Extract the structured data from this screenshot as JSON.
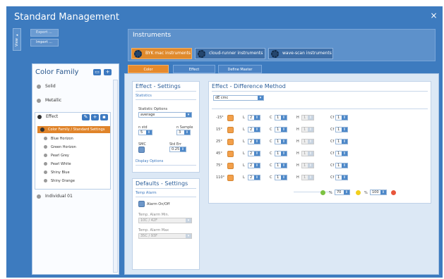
{
  "window": {
    "title": "Standard Management",
    "close_icon": "×",
    "view_tab": "View ▸"
  },
  "top_left_buttons": {
    "export": "Export ...",
    "import": "Import ..."
  },
  "instruments": {
    "title": "Instruments",
    "items": [
      {
        "label": "BYK mac instruments",
        "active": true
      },
      {
        "label": "cloud-runner instruments",
        "active": false
      },
      {
        "label": "wave-scan instruments",
        "active": false
      }
    ]
  },
  "color_family": {
    "title": "Color Family",
    "nodes": [
      "Solid",
      "Metallic",
      "Effect",
      "Individual 01"
    ],
    "effect_selected": "Color Family / Standard Settings",
    "effect_children": [
      "Blue Horizon",
      "Green Horizon",
      "Pearl Grey",
      "Pearl White",
      "Shiny Blue",
      "Shiny Orange"
    ]
  },
  "tabs": [
    "Color",
    "Effect",
    "Define Master"
  ],
  "effect_settings": {
    "title": "Effect - Settings",
    "statistics_header": "Statistics",
    "statistic_options_label": "Statistic Options",
    "statistic_options_value": "average",
    "n_std_label": "n std",
    "n_std_value": "5",
    "n_sample_label": "n Sample",
    "n_sample_value": "3",
    "smc_label": "SMC",
    "std_err_label": "Std Err",
    "std_err_value": "0.25",
    "display_options": "Display Options"
  },
  "defaults_settings": {
    "title": "Defaults - Settings",
    "temp_alarm_header": "Temp Alarm",
    "alarm_label": "Alarm On/Off",
    "alarm_min_label": "Temp. Alarm Min.",
    "alarm_min_value": "10C / 42F",
    "alarm_max_label": "Temp. Alarm Max",
    "alarm_max_value": "35C / 93F"
  },
  "difference_method": {
    "title": "Effect - Difference Method",
    "method": "dE cmc",
    "rows": [
      {
        "angle": "-15°",
        "L": "2",
        "C": "1",
        "H": "1",
        "Cf": "1"
      },
      {
        "angle": "15°",
        "L": "2",
        "C": "1",
        "H": "1",
        "Cf": "1"
      },
      {
        "angle": "25°",
        "L": "2",
        "C": "1",
        "H": "1",
        "Cf": "1"
      },
      {
        "angle": "45°",
        "L": "2",
        "C": "1",
        "H": "1",
        "Cf": "1"
      },
      {
        "angle": "75°",
        "L": "2",
        "C": "1",
        "H": "1",
        "Cf": "1"
      },
      {
        "angle": "110°",
        "L": "2",
        "C": "1",
        "H": "1",
        "Cf": "1"
      }
    ],
    "labels": {
      "L": "L",
      "C": "C",
      "H": "H",
      "Cf": "Cf"
    },
    "threshold_1": "70",
    "threshold_2": "100",
    "percent": "%",
    "colors": {
      "green": "#7cc242",
      "yellow": "#f2cf1d",
      "red": "#e8553b"
    }
  },
  "accent": "#e08a2c",
  "brand": "#3d7bbf"
}
